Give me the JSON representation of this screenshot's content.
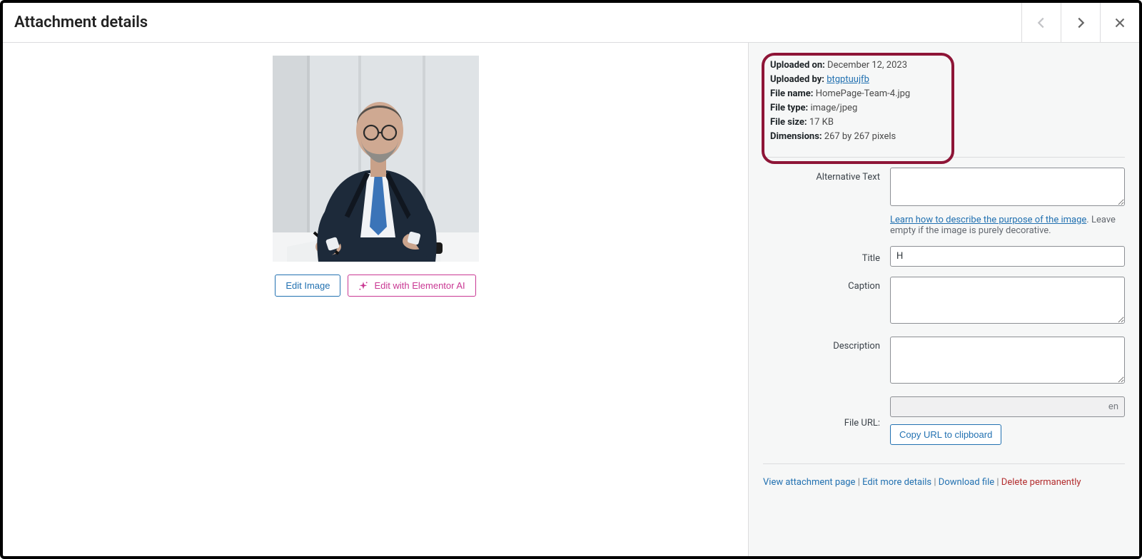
{
  "header": {
    "title": "Attachment details"
  },
  "meta": {
    "uploaded_on_label": "Uploaded on:",
    "uploaded_on": "December 12, 2023",
    "uploaded_by_label": "Uploaded by:",
    "uploaded_by": "btgptuujfb",
    "file_name_label": "File name:",
    "file_name": "HomePage-Team-4.jpg",
    "file_type_label": "File type:",
    "file_type": "image/jpeg",
    "file_size_label": "File size:",
    "file_size": "17 KB",
    "dimensions_label": "Dimensions:",
    "dimensions": "267 by 267 pixels"
  },
  "buttons": {
    "edit_image": "Edit Image",
    "edit_elementor": "Edit with Elementor AI",
    "copy_url": "Copy URL to clipboard"
  },
  "form": {
    "alt_label": "Alternative Text",
    "alt_value": "",
    "alt_help_link": "Learn how to describe the purpose of the image",
    "alt_help_text": "Leave empty if the image is purely decorative.",
    "title_label": "Title",
    "title_value": "H",
    "caption_label": "Caption",
    "caption_value": "",
    "description_label": "Description",
    "description_value": "",
    "file_url_label": "File URL:",
    "file_url_value": "en"
  },
  "actions": {
    "view_page": "View attachment page",
    "edit_more": "Edit more details",
    "download": "Download file",
    "delete": "Delete permanently",
    "dot_after_alt_help_link": "."
  }
}
